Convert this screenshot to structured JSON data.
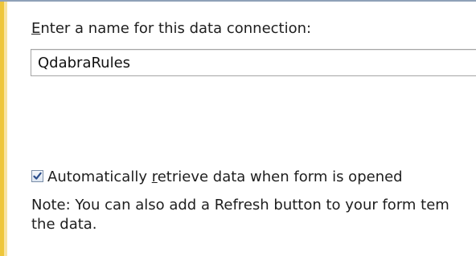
{
  "dialog": {
    "name_label": {
      "access_key": "E",
      "rest": "nter a name for this data connection:"
    },
    "name_input": {
      "value": "QdabraRules",
      "placeholder": ""
    },
    "auto_retrieve": {
      "checked": true,
      "label_before": "Automatically ",
      "access_key": "r",
      "label_after": "etrieve data when form is opened"
    },
    "note": {
      "line1": "Note: You can also add a Refresh button to your form tem",
      "line2": "the data."
    }
  },
  "colors": {
    "accent_bar": "#eec63a",
    "top_rule": "#8fa1b8",
    "checkbox_check": "#2b4e8c"
  }
}
